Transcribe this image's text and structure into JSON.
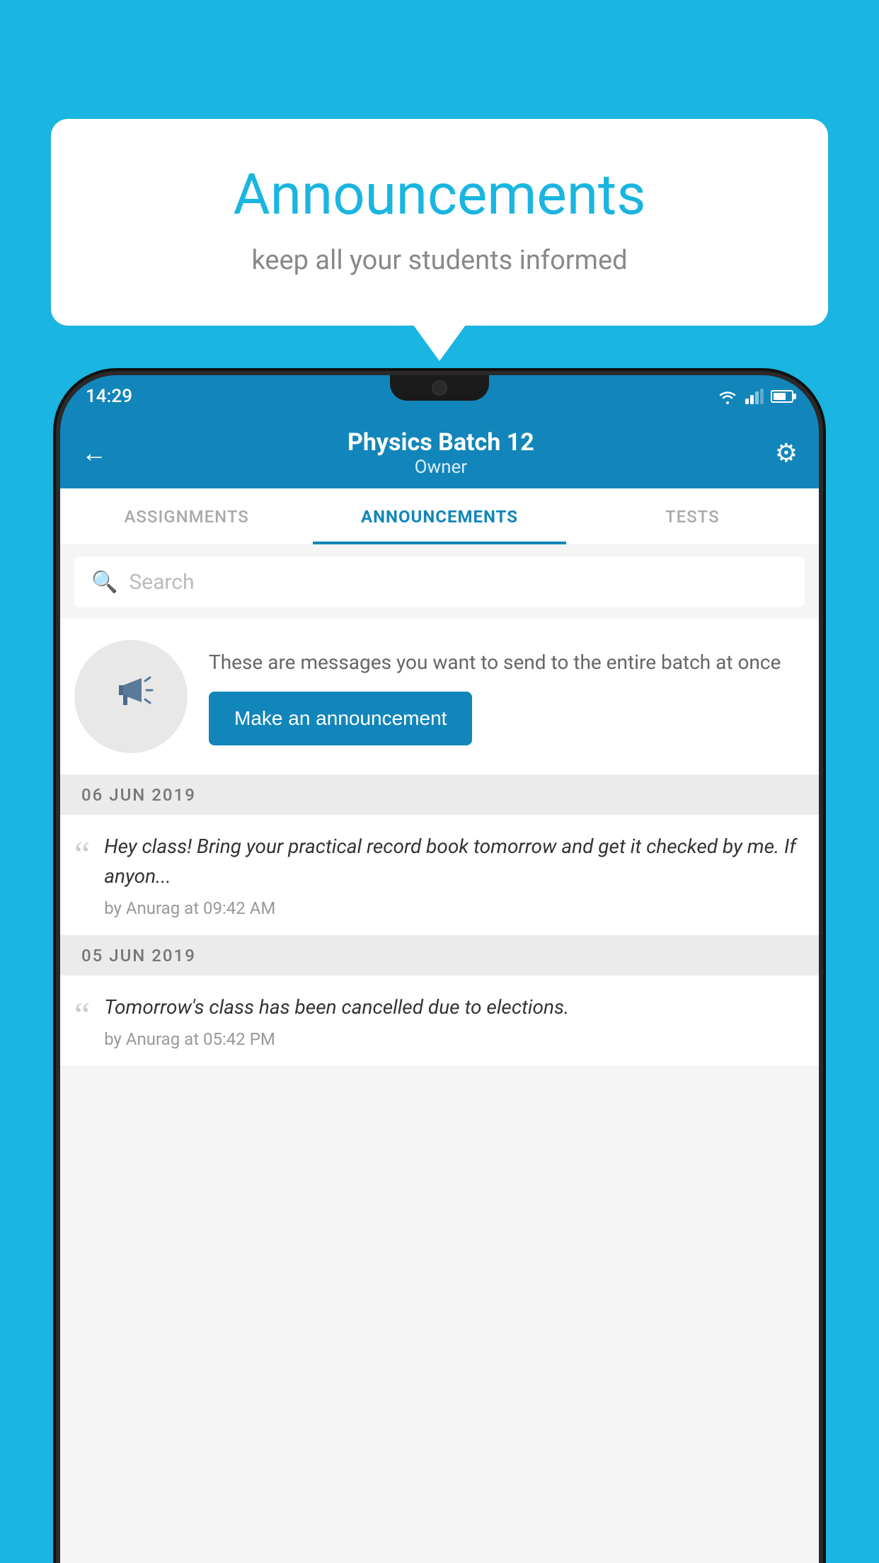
{
  "background_color": "#1ab5e0",
  "speech_bubble": {
    "title": "Announcements",
    "subtitle": "keep all your students informed"
  },
  "phone": {
    "status_bar": {
      "time": "14:29"
    },
    "header": {
      "title": "Physics Batch 12",
      "subtitle": "Owner",
      "back_label": "←",
      "gear_label": "⚙"
    },
    "tabs": [
      {
        "label": "ASSIGNMENTS",
        "active": false
      },
      {
        "label": "ANNOUNCEMENTS",
        "active": true
      },
      {
        "label": "TESTS",
        "active": false
      }
    ],
    "search": {
      "placeholder": "Search"
    },
    "announcement_prompt": {
      "description": "These are messages you want to send to the entire batch at once",
      "button_label": "Make an announcement"
    },
    "announcements": [
      {
        "date": "06  JUN  2019",
        "text": "Hey class! Bring your practical record book tomorrow and get it checked by me. If anyon...",
        "meta": "by Anurag at 09:42 AM"
      },
      {
        "date": "05  JUN  2019",
        "text": "Tomorrow's class has been cancelled due to elections.",
        "meta": "by Anurag at 05:42 PM"
      }
    ]
  }
}
